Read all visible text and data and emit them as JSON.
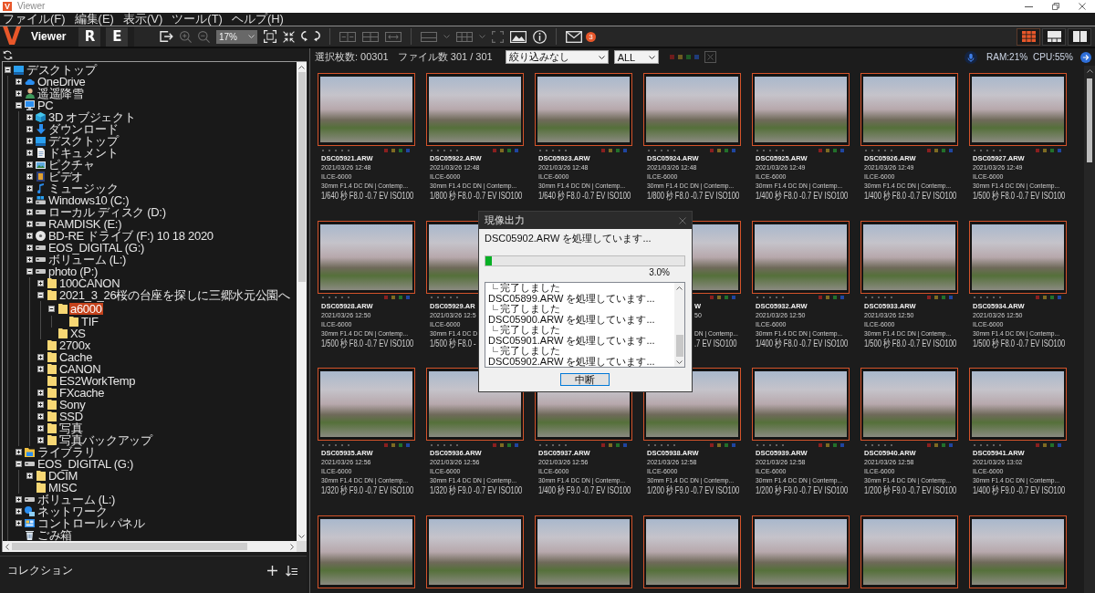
{
  "window": {
    "icon_letter": "V",
    "title": "Viewer"
  },
  "menu": [
    "ファイル(F)",
    "編集(E)",
    "表示(V)",
    "ツール(T)",
    "ヘルプ(H)"
  ],
  "toolbar": {
    "logo": "V",
    "app_name": "Viewer",
    "modes": [
      {
        "label": "R"
      },
      {
        "label": "E"
      }
    ],
    "groups": [
      [
        {
          "kind": "export",
          "disabled": false
        },
        {
          "kind": "zoom-in",
          "disabled": true
        },
        {
          "kind": "zoom-out",
          "disabled": true
        },
        {
          "kind": "zoom-select",
          "value": "17%",
          "disabled": true
        },
        {
          "kind": "fit",
          "disabled": false
        },
        {
          "kind": "actual-size",
          "disabled": false
        },
        {
          "kind": "rotate-left",
          "disabled": false
        },
        {
          "kind": "rotate-right",
          "disabled": false
        }
      ],
      [
        {
          "kind": "compare-side",
          "disabled": true
        },
        {
          "kind": "compare-grid",
          "disabled": true
        },
        {
          "kind": "compare-split",
          "disabled": true
        }
      ],
      [
        {
          "kind": "layout-menu",
          "disabled": true
        },
        {
          "kind": "grid-menu",
          "disabled": true
        },
        {
          "kind": "fullscreen",
          "disabled": true
        },
        {
          "kind": "image",
          "disabled": false
        },
        {
          "kind": "info",
          "disabled": false
        }
      ],
      [
        {
          "kind": "mail",
          "disabled": false,
          "badge": "3"
        }
      ]
    ],
    "view_modes": [
      {
        "kind": "grid",
        "selected": true
      },
      {
        "kind": "filmstrip",
        "selected": false
      },
      {
        "kind": "split",
        "selected": false
      }
    ]
  },
  "sidebar": {
    "tree": [
      {
        "label": "デスクトップ",
        "kind": "desktop",
        "expanded": true,
        "selected": false,
        "children": [
          {
            "label": "OneDrive",
            "kind": "cloud",
            "expanded": false,
            "selected": false
          },
          {
            "label": "遥遥降雪",
            "kind": "user",
            "expanded": false,
            "selected": false
          },
          {
            "label": "PC",
            "kind": "pc",
            "expanded": true,
            "selected": false,
            "children": [
              {
                "label": "3D オブジェクト",
                "kind": "cube",
                "expanded": false,
                "selected": false
              },
              {
                "label": "ダウンロード",
                "kind": "download",
                "expanded": false,
                "selected": false
              },
              {
                "label": "デスクトップ",
                "kind": "desktop",
                "expanded": false,
                "selected": false
              },
              {
                "label": "ドキュメント",
                "kind": "document",
                "expanded": false,
                "selected": false
              },
              {
                "label": "ピクチャ",
                "kind": "picture",
                "expanded": false,
                "selected": false
              },
              {
                "label": "ビデオ",
                "kind": "video",
                "expanded": false,
                "selected": false
              },
              {
                "label": "ミュージック",
                "kind": "music",
                "expanded": false,
                "selected": false
              },
              {
                "label": "Windows10 (C:)",
                "kind": "system-drive",
                "expanded": false,
                "selected": false
              },
              {
                "label": "ローカル ディスク (D:)",
                "kind": "drive",
                "expanded": false,
                "selected": false
              },
              {
                "label": "RAMDISK (E:)",
                "kind": "drive",
                "expanded": false,
                "selected": false
              },
              {
                "label": "BD-RE ドライブ (F:) 10 18 2020",
                "kind": "disc",
                "expanded": false,
                "selected": false
              },
              {
                "label": "EOS_DIGITAL (G:)",
                "kind": "drive",
                "expanded": false,
                "selected": false
              },
              {
                "label": "ボリューム (L:)",
                "kind": "drive",
                "expanded": false,
                "selected": false
              },
              {
                "label": "photo (P:)",
                "kind": "drive",
                "expanded": true,
                "selected": false,
                "children": [
                  {
                    "label": "100CANON",
                    "kind": "folder",
                    "expanded": false,
                    "selected": false
                  },
                  {
                    "label": "2021_3_26桜の台座を探しに三郷水元公園へ",
                    "kind": "folder",
                    "expanded": true,
                    "selected": false,
                    "children": [
                      {
                        "label": "a6000",
                        "kind": "folder",
                        "expanded": true,
                        "selected": true,
                        "children": [
                          {
                            "label": "TIF",
                            "kind": "folder",
                            "selected": false
                          }
                        ]
                      },
                      {
                        "label": "XS",
                        "kind": "folder",
                        "selected": false
                      }
                    ]
                  },
                  {
                    "label": "2700x",
                    "kind": "folder",
                    "selected": false
                  },
                  {
                    "label": "Cache",
                    "kind": "folder",
                    "expanded": false,
                    "selected": false
                  },
                  {
                    "label": "CANON",
                    "kind": "folder",
                    "expanded": false,
                    "selected": false
                  },
                  {
                    "label": "ES2WorkTemp",
                    "kind": "folder",
                    "selected": false
                  },
                  {
                    "label": "FXcache",
                    "kind": "folder",
                    "expanded": false,
                    "selected": false
                  },
                  {
                    "label": "Sony",
                    "kind": "folder",
                    "expanded": false,
                    "selected": false
                  },
                  {
                    "label": "SSD",
                    "kind": "folder",
                    "expanded": false,
                    "selected": false
                  },
                  {
                    "label": "写真",
                    "kind": "folder",
                    "expanded": false,
                    "selected": false
                  },
                  {
                    "label": "写真バックアップ",
                    "kind": "folder",
                    "expanded": false,
                    "selected": false
                  }
                ]
              }
            ]
          },
          {
            "label": "ライブラリ",
            "kind": "library",
            "expanded": false,
            "selected": false
          },
          {
            "label": "EOS_DIGITAL (G:)",
            "kind": "drive",
            "expanded": true,
            "selected": false,
            "children": [
              {
                "label": "DCIM",
                "kind": "folder",
                "expanded": false,
                "selected": false
              },
              {
                "label": "MISC",
                "kind": "folder",
                "selected": false
              }
            ]
          },
          {
            "label": "ボリューム (L:)",
            "kind": "drive",
            "expanded": false,
            "selected": false
          },
          {
            "label": "ネットワーク",
            "kind": "network",
            "expanded": false,
            "selected": false
          },
          {
            "label": "コントロール パネル",
            "kind": "control-panel",
            "expanded": false,
            "selected": false
          },
          {
            "label": "ごみ箱",
            "kind": "trash",
            "selected": false
          }
        ]
      }
    ],
    "collection": {
      "title": "コレクション"
    }
  },
  "filter_bar": {
    "selected_count": "選択枚数: 00301",
    "file_count": "ファイル数 301 / 301",
    "filter": "絞り込みなし",
    "category": "ALL",
    "color_filters": [
      {
        "color": "#6e1c1c"
      },
      {
        "color": "#6b5b22"
      },
      {
        "color": "#1d5a26"
      },
      {
        "color": "#1f3b7a"
      }
    ],
    "ram": "RAM:21%",
    "cpu": "CPU:55%"
  },
  "thumbnails": {
    "label_colors": [
      {
        "color": "#8a1f1f"
      },
      {
        "color": "#7d6a22"
      },
      {
        "color": "#22702a"
      },
      {
        "color": "#1f45a0"
      }
    ],
    "rows": [
      {
        "cards": [
          {
            "kind": "full",
            "selected": true,
            "stars": 0,
            "name": "DSC05921.ARW",
            "date": "2021/03/26 12:48",
            "model": "ILCE-6000",
            "lens": "30mm F1.4 DC DN | Contemp...",
            "exposure": "1/640 秒 F8.0 -0.7 EV ISO100"
          },
          {
            "kind": "full",
            "selected": true,
            "stars": 0,
            "name": "DSC05922.ARW",
            "date": "2021/03/26 12:48",
            "model": "ILCE-6000",
            "lens": "30mm F1.4 DC DN | Contemp...",
            "exposure": "1/800 秒 F8.0 -0.7 EV ISO100"
          },
          {
            "kind": "full",
            "selected": true,
            "stars": 0,
            "name": "DSC05923.ARW",
            "date": "2021/03/26 12:48",
            "model": "ILCE-6000",
            "lens": "30mm F1.4 DC DN | Contemp...",
            "exposure": "1/640 秒 F8.0 -0.7 EV ISO100"
          },
          {
            "kind": "full",
            "selected": true,
            "stars": 0,
            "name": "DSC05924.ARW",
            "date": "2021/03/26 12:48",
            "model": "ILCE-6000",
            "lens": "30mm F1.4 DC DN | Contemp...",
            "exposure": "1/800 秒 F8.0 -0.7 EV ISO100"
          },
          {
            "kind": "full",
            "selected": true,
            "stars": 0,
            "name": "DSC05925.ARW",
            "date": "2021/03/26 12:49",
            "model": "ILCE-6000",
            "lens": "30mm F1.4 DC DN | Contemp...",
            "exposure": "1/400 秒 F8.0 -0.7 EV ISO100"
          },
          {
            "kind": "full",
            "selected": true,
            "stars": 0,
            "name": "DSC05926.ARW",
            "date": "2021/03/26 12:49",
            "model": "ILCE-6000",
            "lens": "30mm F1.4 DC DN | Contemp...",
            "exposure": "1/400 秒 F8.0 -0.7 EV ISO100"
          },
          {
            "kind": "full",
            "selected": true,
            "stars": 0,
            "name": "DSC05927.ARW",
            "date": "2021/03/26 12:49",
            "model": "ILCE-6000",
            "lens": "30mm F1.4 DC DN | Contemp...",
            "exposure": "1/500 秒 F8.0 -0.7 EV ISO100"
          }
        ]
      },
      {
        "cards": [
          {
            "kind": "full",
            "selected": true,
            "stars": 0,
            "name": "DSC05928.ARW",
            "date": "2021/03/26 12:50",
            "model": "ILCE-6000",
            "lens": "30mm F1.4 DC DN | Contemp...",
            "exposure": "1/500 秒 F8.0 -0.7 EV ISO100"
          },
          {
            "kind": "cut-right",
            "selected": true,
            "stars": 0,
            "name": "DSC05929.AR",
            "date": "2021/03/26 12:5",
            "model": "ILCE-6000",
            "lens": "30mm F1.4 DC D",
            "exposure": "1/500 秒 F8.0 -"
          },
          {
            "kind": "covered"
          },
          {
            "kind": "cut-left",
            "selected": true,
            "name": "W",
            "date": "50",
            "lens": "DN | Contemp...",
            "exposure": ".7 EV ISO100"
          },
          {
            "kind": "full",
            "selected": true,
            "stars": 0,
            "name": "DSC05932.ARW",
            "date": "2021/03/26 12:50",
            "model": "ILCE-6000",
            "lens": "30mm F1.4 DC DN | Contemp...",
            "exposure": "1/400 秒 F8.0 -0.7 EV ISO100"
          },
          {
            "kind": "full",
            "selected": true,
            "stars": 0,
            "name": "DSC05933.ARW",
            "date": "2021/03/26 12:50",
            "model": "ILCE-6000",
            "lens": "30mm F1.4 DC DN | Contemp...",
            "exposure": "1/500 秒 F8.0 -0.7 EV ISO100"
          },
          {
            "kind": "full",
            "selected": true,
            "stars": 0,
            "name": "DSC05934.ARW",
            "date": "2021/03/26 12:50",
            "model": "ILCE-6000",
            "lens": "30mm F1.4 DC DN | Contemp...",
            "exposure": "1/500 秒 F8.0 -0.7 EV ISO100"
          }
        ]
      },
      {
        "cards": [
          {
            "kind": "full",
            "selected": true,
            "stars": 0,
            "name": "DSC05935.ARW",
            "date": "2021/03/26 12:56",
            "model": "ILCE-6000",
            "lens": "30mm F1.4 DC DN | Contemp...",
            "exposure": "1/320 秒 F9.0 -0.7 EV ISO100"
          },
          {
            "kind": "full",
            "selected": true,
            "stars": 0,
            "name": "DSC05936.ARW",
            "date": "2021/03/26 12:56",
            "model": "ILCE-6000",
            "lens": "30mm F1.4 DC DN | Contemp...",
            "exposure": "1/320 秒 F9.0 -0.7 EV ISO100"
          },
          {
            "kind": "full",
            "selected": true,
            "stars": 0,
            "name": "DSC05937.ARW",
            "date": "2021/03/26 12:56",
            "model": "ILCE-6000",
            "lens": "30mm F1.4 DC DN | Contemp...",
            "exposure": "1/400 秒 F9.0 -0.7 EV ISO100"
          },
          {
            "kind": "full",
            "selected": true,
            "stars": 0,
            "name": "DSC05938.ARW",
            "date": "2021/03/26 12:58",
            "model": "ILCE-6000",
            "lens": "30mm F1.4 DC DN | Contemp...",
            "exposure": "1/200 秒 F9.0 -0.7 EV ISO100"
          },
          {
            "kind": "full",
            "selected": true,
            "stars": 0,
            "name": "DSC05939.ARW",
            "date": "2021/03/26 12:58",
            "model": "ILCE-6000",
            "lens": "30mm F1.4 DC DN | Contemp...",
            "exposure": "1/200 秒 F9.0 -0.7 EV ISO100"
          },
          {
            "kind": "full",
            "selected": true,
            "stars": 0,
            "name": "DSC05940.ARW",
            "date": "2021/03/26 12:58",
            "model": "ILCE-6000",
            "lens": "30mm F1.4 DC DN | Contemp...",
            "exposure": "1/200 秒 F9.0 -0.7 EV ISO100"
          },
          {
            "kind": "full",
            "selected": true,
            "stars": 0,
            "name": "DSC05941.ARW",
            "date": "2021/03/26 13:02",
            "model": "ILCE-6000",
            "lens": "30mm F1.4 DC DN | Contemp...",
            "exposure": "1/400 秒 F9.0 -0.7 EV ISO100"
          }
        ]
      },
      {
        "cards": [
          {
            "kind": "photo-only",
            "selected": true
          },
          {
            "kind": "photo-only",
            "selected": true
          },
          {
            "kind": "photo-only",
            "selected": true
          },
          {
            "kind": "photo-only",
            "selected": true
          },
          {
            "kind": "photo-only",
            "selected": true
          },
          {
            "kind": "photo-only",
            "selected": true
          },
          {
            "kind": "photo-only",
            "selected": true
          }
        ]
      }
    ]
  },
  "dialog": {
    "title": "現像出力",
    "message": "DSC05902.ARW を処理しています...",
    "progress": {
      "level": 0.03,
      "reading": "3.0%"
    },
    "log": [
      {
        "kind": "result",
        "text": "完了しました"
      },
      {
        "kind": "file",
        "text": "DSC05899.ARW を処理しています..."
      },
      {
        "kind": "result",
        "text": "完了しました"
      },
      {
        "kind": "file",
        "text": "DSC05900.ARW を処理しています..."
      },
      {
        "kind": "result",
        "text": "完了しました"
      },
      {
        "kind": "file",
        "text": "DSC05901.ARW を処理しています..."
      },
      {
        "kind": "result",
        "text": "完了しました"
      },
      {
        "kind": "file",
        "text": "DSC05902.ARW を処理しています..."
      }
    ],
    "button": "中断"
  }
}
